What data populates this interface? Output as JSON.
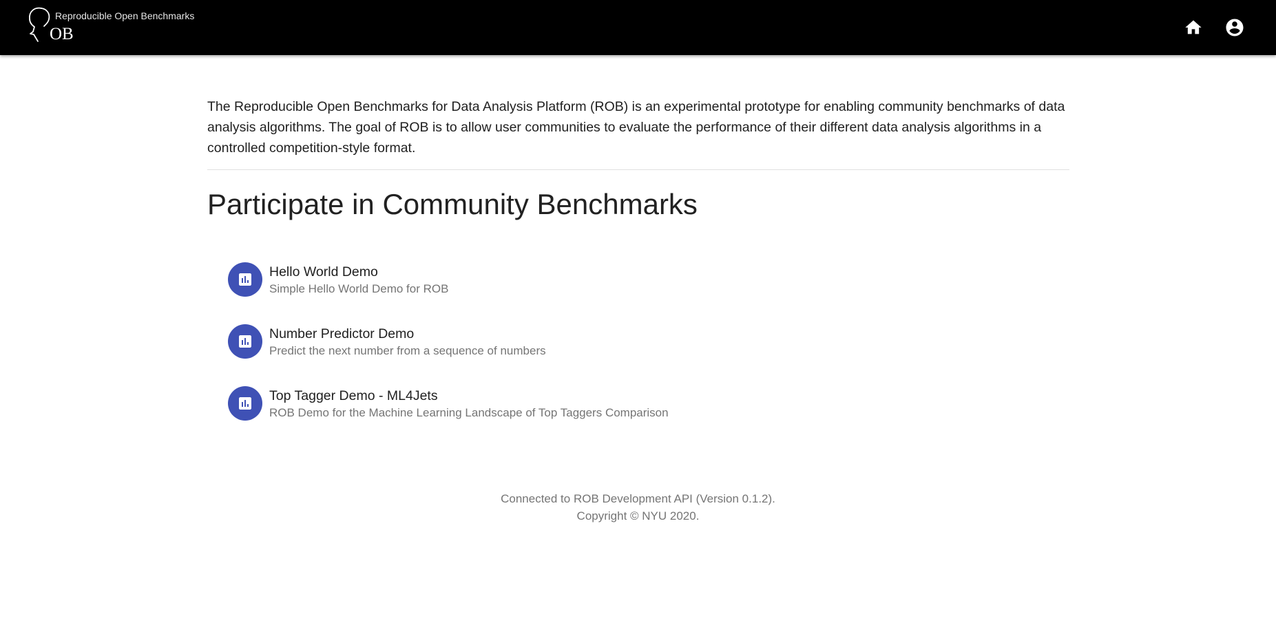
{
  "header": {
    "logo_tagline": "Reproducible Open Benchmarks",
    "logo_mark": "OB",
    "home_icon": "home-icon",
    "account_icon": "account-circle-icon"
  },
  "intro": {
    "text": "The Reproducible Open Benchmarks for Data Analysis Platform (ROB) is an experimental prototype for enabling community benchmarks of data analysis algorithms. The goal of ROB is to allow user communities to evaluate the performance of their different data analysis algorithms in a controlled competition-style format."
  },
  "benchmarks": {
    "title": "Participate in Community Benchmarks",
    "items": [
      {
        "name": "Hello World Demo",
        "description": "Simple Hello World Demo for ROB",
        "icon": "bar-chart-icon"
      },
      {
        "name": "Number Predictor Demo",
        "description": "Predict the next number from a sequence of numbers",
        "icon": "bar-chart-icon"
      },
      {
        "name": "Top Tagger Demo - ML4Jets",
        "description": "ROB Demo for the Machine Learning Landscape of Top Taggers Comparison",
        "icon": "bar-chart-icon"
      }
    ]
  },
  "footer": {
    "api_line": "Connected to ROB Development API (Version 0.1.2).",
    "copyright": "Copyright © NYU 2020."
  },
  "colors": {
    "appbar": "#000000",
    "accent": "#3f51b5",
    "text_primary": "#212121",
    "text_secondary": "#757575"
  }
}
